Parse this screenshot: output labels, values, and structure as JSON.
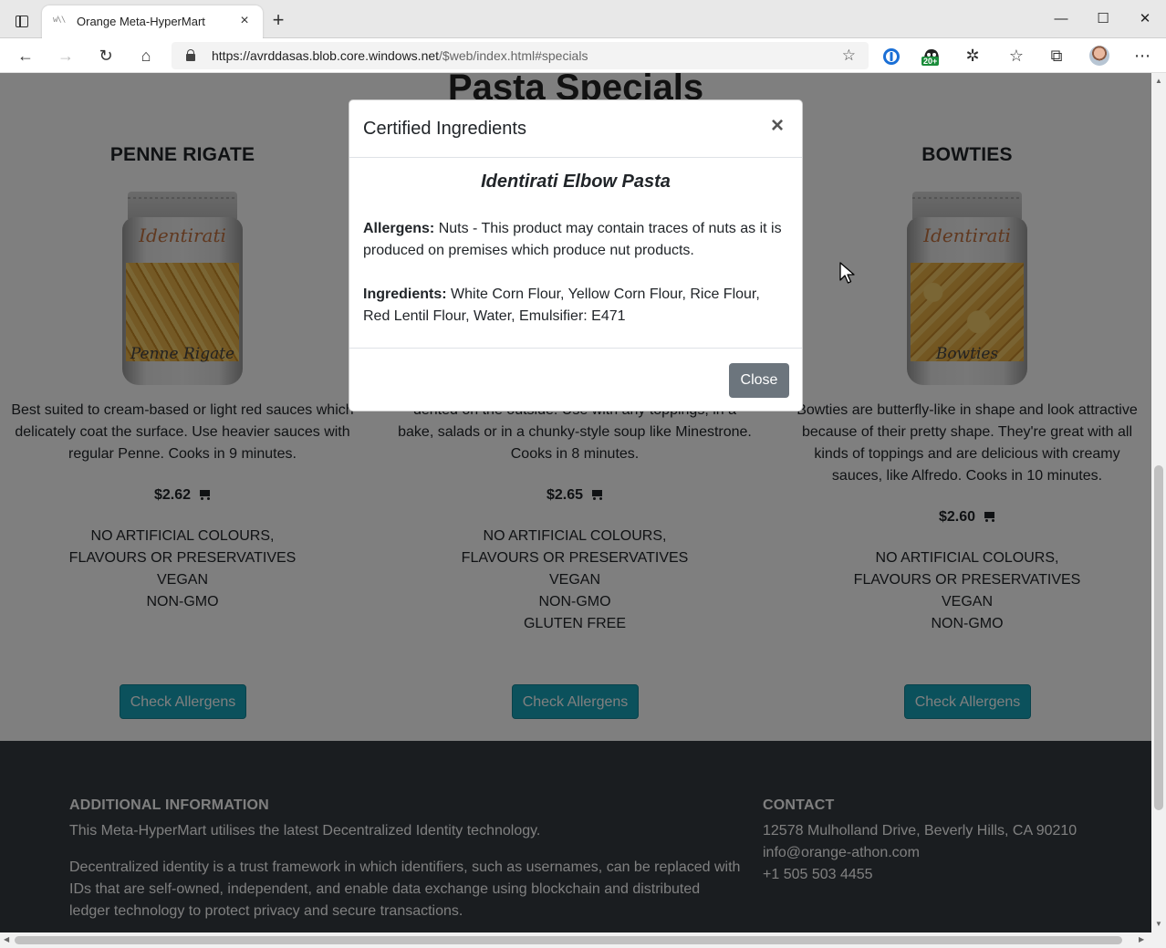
{
  "browser": {
    "tab_title": "Orange Meta-HyperMart",
    "tab_favicon": "w\\\\",
    "url_host": "https://avrddasas.blob.core.windows.net",
    "url_path": "/$web/index.html#specials",
    "extension_badge": "20+"
  },
  "page": {
    "section_title": "Pasta Specials",
    "products": [
      {
        "name": "PENNE RIGATE",
        "bag_brand": "Identirati",
        "bag_label": "Penne Rigate",
        "description": "Best suited to cream-based or light red sauces which delicately coat the surface. Use heavier sauces with regular Penne. Cooks in 9 minutes.",
        "price": "$2.62",
        "claims": [
          "NO ARTIFICIAL COLOURS, FLAVOURS OR PRESERVATIVES",
          "VEGAN",
          "NON-GMO"
        ],
        "button": "Check Allergens"
      },
      {
        "name": "",
        "description": "A highly versatile shape hollow on the inside and dented on the outside. Use with any toppings, in a bake, salads or in a chunky-style soup like Minestrone. Cooks in 8 minutes.",
        "price": "$2.65",
        "claims": [
          "NO ARTIFICIAL COLOURS, FLAVOURS OR PRESERVATIVES",
          "VEGAN",
          "NON-GMO",
          "GLUTEN FREE"
        ],
        "button": "Check Allergens"
      },
      {
        "name": "BOWTIES",
        "bag_brand": "Identirati",
        "bag_label": "Bowties",
        "description": "Bowties are butterfly-like in shape and look attractive because of their pretty shape. They're great with all kinds of toppings and are delicious with creamy sauces, like Alfredo. Cooks in 10 minutes.",
        "price": "$2.60",
        "claims": [
          "NO ARTIFICIAL COLOURS, FLAVOURS OR PRESERVATIVES",
          "VEGAN",
          "NON-GMO"
        ],
        "button": "Check Allergens"
      }
    ]
  },
  "footer": {
    "info_heading": "ADDITIONAL INFORMATION",
    "info_line1": "This Meta-HyperMart utilises the latest Decentralized Identity technology.",
    "info_line2": "Decentralized identity is a trust framework in which identifiers, such as usernames, can be replaced with IDs that are self-owned, independent, and enable data exchange using blockchain and distributed ledger technology to protect privacy and secure transactions.",
    "contact_heading": "CONTACT",
    "address": "12578 Mulholland Drive, Beverly Hills, CA 90210",
    "email": "info@orange-athon.com",
    "phone": "+1 505 503 4455"
  },
  "modal": {
    "title": "Certified Ingredients",
    "product_name": "Identirati Elbow Pasta",
    "allergens_label": "Allergens:",
    "allergens_text": "Nuts - This product may contain traces of nuts as it is produced on premises which produce nut products.",
    "ingredients_label": "Ingredients:",
    "ingredients_text": "White Corn Flour, Yellow Corn Flour, Rice Flour, Red Lentil Flour, Water, Emulsifier: E471",
    "close_label": "Close"
  },
  "colors": {
    "accent": "#17a2b8",
    "footer_bg": "#343a40",
    "close_button": "#6c757d"
  }
}
